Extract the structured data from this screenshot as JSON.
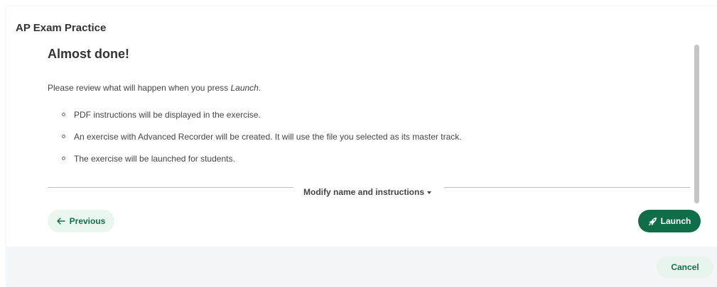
{
  "modal": {
    "title": "AP Exam Practice"
  },
  "content": {
    "heading": "Almost done!",
    "intro_prefix": "Please review what will happen when you press ",
    "intro_emphasis": "Launch",
    "intro_suffix": ".",
    "bullets": [
      "PDF instructions will be displayed in the exercise.",
      "An exercise with Advanced Recorder will be created. It will use the file you selected as its master track.",
      "The exercise will be launched for students."
    ],
    "modify_label": "Modify name and instructions"
  },
  "actions": {
    "previous_label": "Previous",
    "launch_label": "Launch",
    "cancel_label": "Cancel"
  },
  "colors": {
    "primary": "#0f6e47",
    "primary_light": "#eaf7f1",
    "footer_bg": "#f4f5f6"
  },
  "icons": {
    "previous": "arrow-left-icon",
    "launch": "rocket-icon",
    "modify": "caret-down-icon"
  }
}
